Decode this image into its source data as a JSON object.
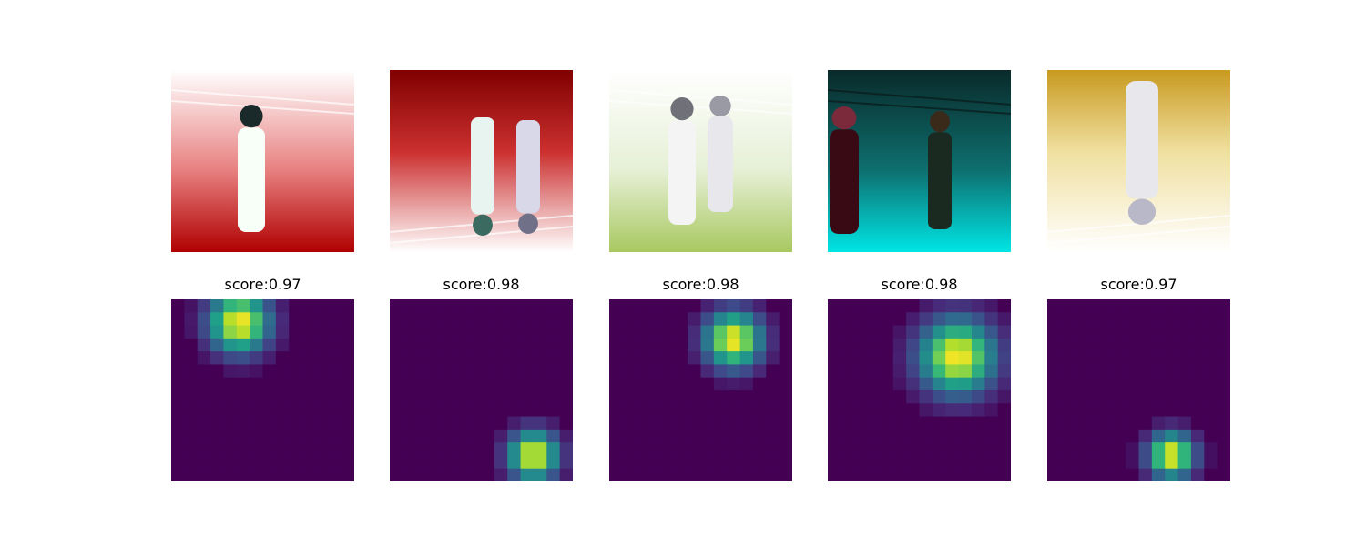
{
  "figure": {
    "photos": [
      {
        "scene": "single-figure-stage",
        "palette": [
          "#ffffff",
          "#e88080",
          "#b00000"
        ]
      },
      {
        "scene": "two-figures-inverted",
        "palette": [
          "#ffffff",
          "#cc3030",
          "#800000"
        ]
      },
      {
        "scene": "two-figures-standing",
        "palette": [
          "#ffffff",
          "#e6f0d6",
          "#a8c860"
        ]
      },
      {
        "scene": "two-figures-teal-stage",
        "palette": [
          "#0a2a2a",
          "#0e6f6f",
          "#00e5e5"
        ]
      },
      {
        "scene": "inverted-figure-yellow",
        "palette": [
          "#ffffff",
          "#f0e0a0",
          "#c89a20"
        ]
      }
    ],
    "colors": {
      "viridis_low": "#440154",
      "viridis_mid": "#21908d",
      "viridis_high": "#fde725"
    }
  },
  "chart_data": {
    "type": "heatmap",
    "grid": [
      14,
      14
    ],
    "panels": [
      {
        "title": "score:0.97",
        "center": [
          4.7,
          1.3
        ],
        "sigma": 1.6,
        "peak": 1.0
      },
      {
        "title": "score:0.98",
        "center": [
          10.5,
          11.5
        ],
        "sigma": 1.3,
        "peak": 1.0
      },
      {
        "title": "score:0.98",
        "center": [
          9.0,
          2.6
        ],
        "sigma": 1.5,
        "peak": 1.0
      },
      {
        "title": "score:0.98",
        "center": [
          9.4,
          3.9
        ],
        "sigma": 2.0,
        "peak": 1.0
      },
      {
        "title": "score:0.97",
        "center": [
          9.0,
          11.5
        ],
        "sigma": 1.2,
        "peak": 1.0
      }
    ]
  }
}
